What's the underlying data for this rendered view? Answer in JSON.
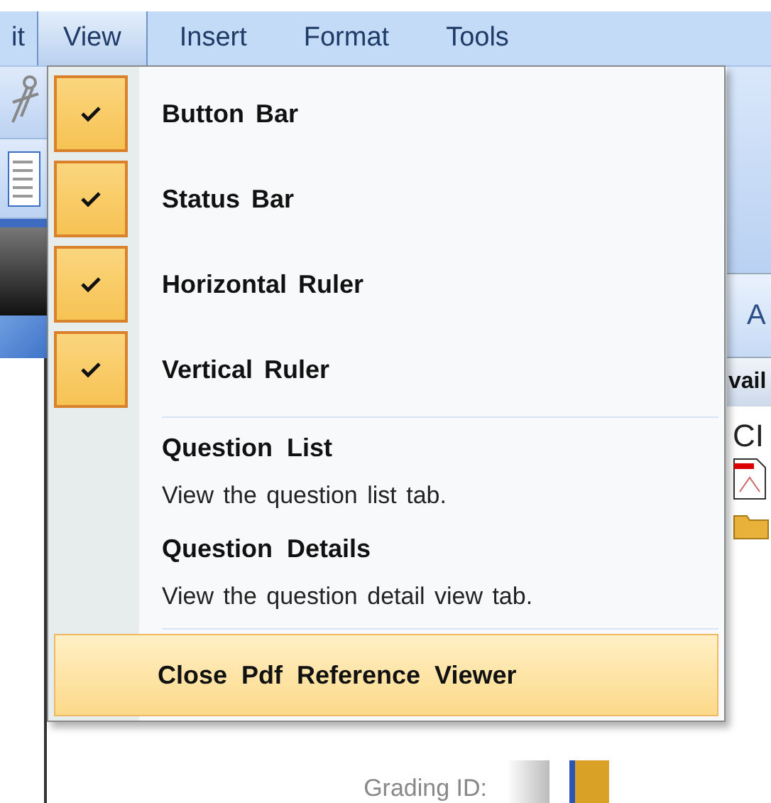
{
  "menubar": [
    {
      "label": "it",
      "selected": false
    },
    {
      "label": "View",
      "selected": true
    },
    {
      "label": "Insert",
      "selected": false
    },
    {
      "label": "Format",
      "selected": false
    },
    {
      "label": "Tools",
      "selected": false
    }
  ],
  "view_menu": {
    "toggles": [
      {
        "label": "Button Bar",
        "checked": true
      },
      {
        "label": "Status Bar",
        "checked": true
      },
      {
        "label": "Horizontal Ruler",
        "checked": true
      },
      {
        "label": "Vertical Ruler",
        "checked": true
      }
    ],
    "commands": [
      {
        "label": "Question List",
        "description": "View the question list tab."
      },
      {
        "label": "Question Details",
        "description": "View the question detail view tab."
      }
    ],
    "last_command": {
      "label": "Close Pdf Reference Viewer",
      "selected": true
    }
  },
  "background": {
    "tab_label": "A",
    "panel_header": "vail",
    "panel_text": "CI",
    "grading_label": "Grading ID:"
  }
}
